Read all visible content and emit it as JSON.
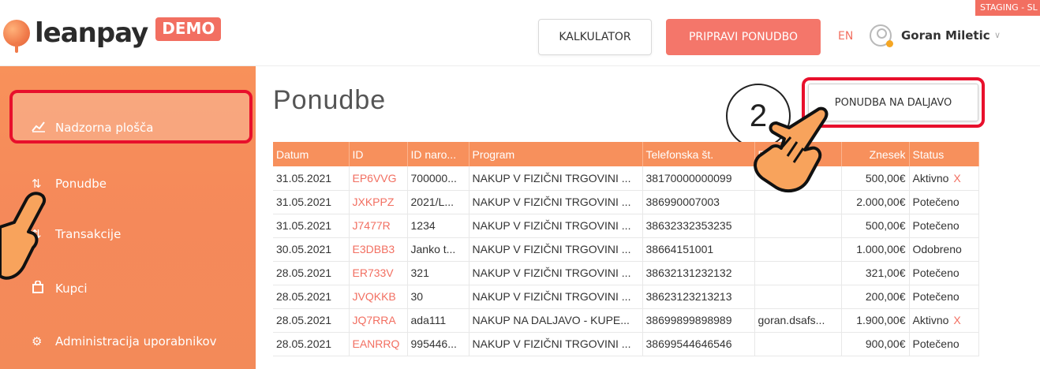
{
  "header": {
    "logo_text": "leanpay",
    "demo_badge": "DEMO",
    "calc_button": "KALKULATOR",
    "prepare_button": "PRIPRAVI PONUDBO",
    "language": "EN",
    "user_name": "Goran Miletic",
    "staging_label": "STAGING - SL"
  },
  "sidebar": {
    "items": [
      {
        "label": "Nadzorna plošča",
        "icon": "chart-icon"
      },
      {
        "label": "Ponudbe",
        "icon": "sort-icon"
      },
      {
        "label": "Transakcije",
        "icon": "sort-icon"
      },
      {
        "label": "Kupci",
        "icon": "bag-icon"
      },
      {
        "label": "Administracija uporabnikov",
        "icon": "gear-icon"
      }
    ]
  },
  "main": {
    "title": "Ponudbe",
    "step_number": "2",
    "remote_offer_button": "PONUDBA NA DALJAVO",
    "columns": [
      "Datum",
      "ID",
      "ID naro...",
      "Program",
      "Telefonska št.",
      "E-",
      "Znesek",
      "Status"
    ],
    "rows": [
      {
        "date": "31.05.2021",
        "id": "EP6VVG",
        "order": "700000...",
        "program": "NAKUP V FIZIČNI TRGOVINI ...",
        "phone": "38170000000099",
        "email": "",
        "amount": "500,00€",
        "status": "Aktivno",
        "x": "X"
      },
      {
        "date": "31.05.2021",
        "id": "JXKPPZ",
        "order": "2021/L...",
        "program": "NAKUP V FIZIČNI TRGOVINI ...",
        "phone": "386990007003",
        "email": "",
        "amount": "2.000,00€",
        "status": "Potečeno",
        "x": ""
      },
      {
        "date": "31.05.2021",
        "id": "J7477R",
        "order": "1234",
        "program": "NAKUP V FIZIČNI TRGOVINI ...",
        "phone": "38632332353235",
        "email": "",
        "amount": "500,00€",
        "status": "Potečeno",
        "x": ""
      },
      {
        "date": "30.05.2021",
        "id": "E3DBB3",
        "order": "Janko t...",
        "program": "NAKUP V FIZIČNI TRGOVINI ...",
        "phone": "38664151001",
        "email": "",
        "amount": "1.000,00€",
        "status": "Odobreno",
        "x": ""
      },
      {
        "date": "28.05.2021",
        "id": "ER733V",
        "order": "321",
        "program": "NAKUP V FIZIČNI TRGOVINI ...",
        "phone": "38632131232132",
        "email": "",
        "amount": "321,00€",
        "status": "Potečeno",
        "x": ""
      },
      {
        "date": "28.05.2021",
        "id": "JVQKKB",
        "order": "30",
        "program": "NAKUP V FIZIČNI TRGOVINI ...",
        "phone": "38623123213213",
        "email": "",
        "amount": "200,00€",
        "status": "Potečeno",
        "x": ""
      },
      {
        "date": "28.05.2021",
        "id": "JQ7RRA",
        "order": "ada111",
        "program": "NAKUP NA DALJAVO - KUPE...",
        "phone": "38699899898989",
        "email": "goran.dsafs...",
        "amount": "1.900,00€",
        "status": "Aktivno",
        "x": "X"
      },
      {
        "date": "28.05.2021",
        "id": "EANRRQ",
        "order": "995446...",
        "program": "NAKUP V FIZIČNI TRGOVINI ...",
        "phone": "38699544646546",
        "email": "",
        "amount": "900,00€",
        "status": "Potečeno",
        "x": ""
      }
    ]
  },
  "colors": {
    "accent": "#f26f61",
    "sidebar": "#f7905c",
    "highlight_ring": "#e8102c"
  }
}
